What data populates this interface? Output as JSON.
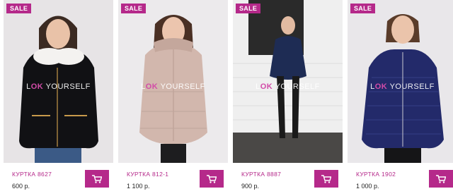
{
  "watermark": {
    "lead": "L",
    "mark": "OK",
    "tail": " YOURSELF"
  },
  "colors": {
    "accent": "#b5298a",
    "price_text": "#222222"
  },
  "products": [
    {
      "badge": "SALE",
      "name": "КУРТКА 8627",
      "price": "600 р.",
      "cart_icon": "cart-icon"
    },
    {
      "badge": "SALE",
      "name": "КУРТКА 812-1",
      "price": "1 100 р.",
      "cart_icon": "cart-icon"
    },
    {
      "badge": "SALE",
      "name": "КУРТКА 8887",
      "price": "900 р.",
      "cart_icon": "cart-icon"
    },
    {
      "badge": "SALE",
      "name": "КУРТКА 1902",
      "price": "1 000 р.",
      "cart_icon": "cart-icon"
    }
  ]
}
